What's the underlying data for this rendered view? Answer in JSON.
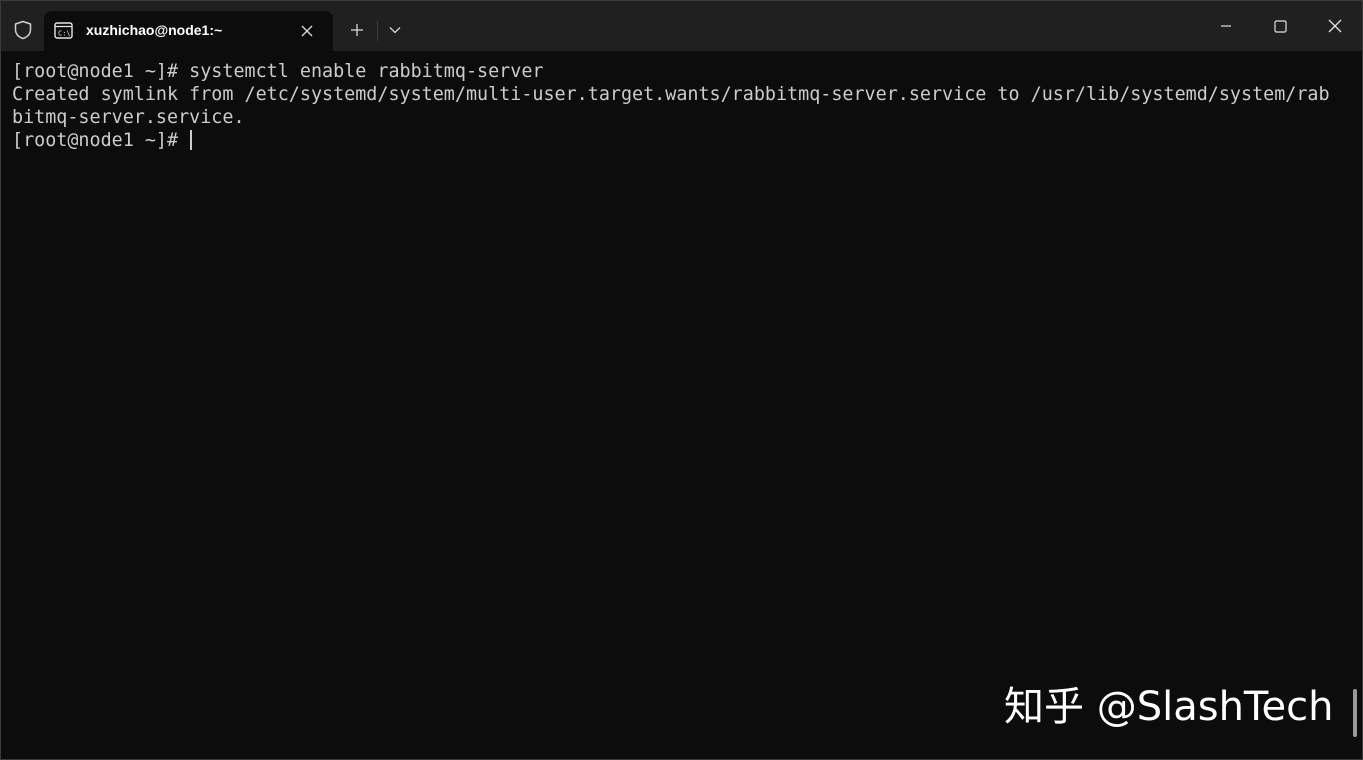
{
  "window": {
    "tab": {
      "title": "xuzhichao@node1:~",
      "icon": "terminal-icon",
      "close_icon": "close-icon"
    },
    "titlebar_icons": {
      "shield": "shield-icon",
      "new_tab": "plus-icon",
      "dropdown": "chevron-down-icon",
      "minimize": "minimize-icon",
      "maximize": "maximize-icon",
      "close": "close-icon"
    },
    "colors": {
      "titlebar": "#202020",
      "background": "#0c0c0c",
      "text": "#cccccc"
    }
  },
  "terminal": {
    "lines": [
      "[root@node1 ~]# systemctl enable rabbitmq-server",
      "Created symlink from /etc/systemd/system/multi-user.target.wants/rabbitmq-server.service to /usr/lib/systemd/system/rab",
      "bitmq-server.service.",
      "[root@node1 ~]# "
    ]
  },
  "watermark": {
    "text": "知乎 @SlashTech"
  }
}
